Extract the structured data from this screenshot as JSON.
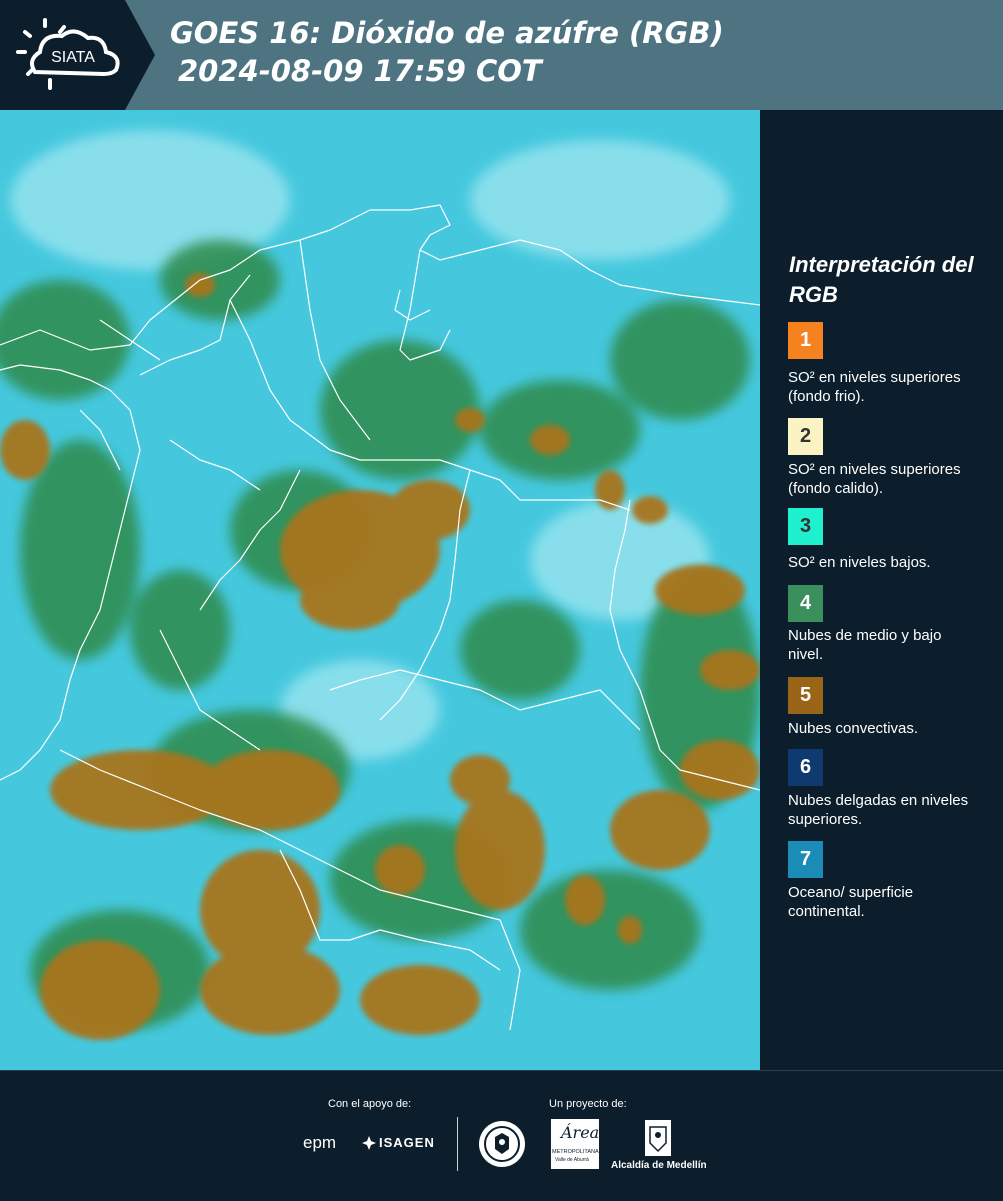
{
  "header": {
    "logo_text": "SIATA",
    "title_line1": "GOES 16: Dióxido de azúfre (RGB)",
    "title_line2": "2024-08-09 17:59 COT"
  },
  "legend": {
    "title": "Interpretación del RGB",
    "items": [
      {
        "number": "1",
        "color": "#f5821f",
        "label": "SO² en niveles superiores (fondo frio)."
      },
      {
        "number": "2",
        "color": "#fbf3c4",
        "label": "SO² en niveles superiores (fondo calido)."
      },
      {
        "number": "3",
        "color": "#1ff0d0",
        "label": "SO² en niveles bajos."
      },
      {
        "number": "4",
        "color": "#3a8f5c",
        "label": "Nubes de medio y bajo nivel."
      },
      {
        "number": "5",
        "color": "#9b6518",
        "label": "Nubes convectivas."
      },
      {
        "number": "6",
        "color": "#0e3a70",
        "label": "Nubes delgadas en niveles superiores."
      },
      {
        "number": "7",
        "color": "#1b8bb8",
        "label": "Oceano/ superficie continental."
      }
    ]
  },
  "footer": {
    "support_label": "Con el apoyo de:",
    "project_label": "Un proyecto de:",
    "sponsor_epm": "epm",
    "sponsor_isagen": "ISAGEN",
    "area_text": "Área",
    "area_subtitle": "METROPOLITANA",
    "area_subtitle2": "Valle de Aburrá",
    "alcaldia_text": "Alcaldía de Medellín"
  },
  "map_colors": {
    "background": "#3cc6dc",
    "convective": "#a8741f",
    "mid_low": "#2f8a4a",
    "borders": "#ffffff"
  }
}
